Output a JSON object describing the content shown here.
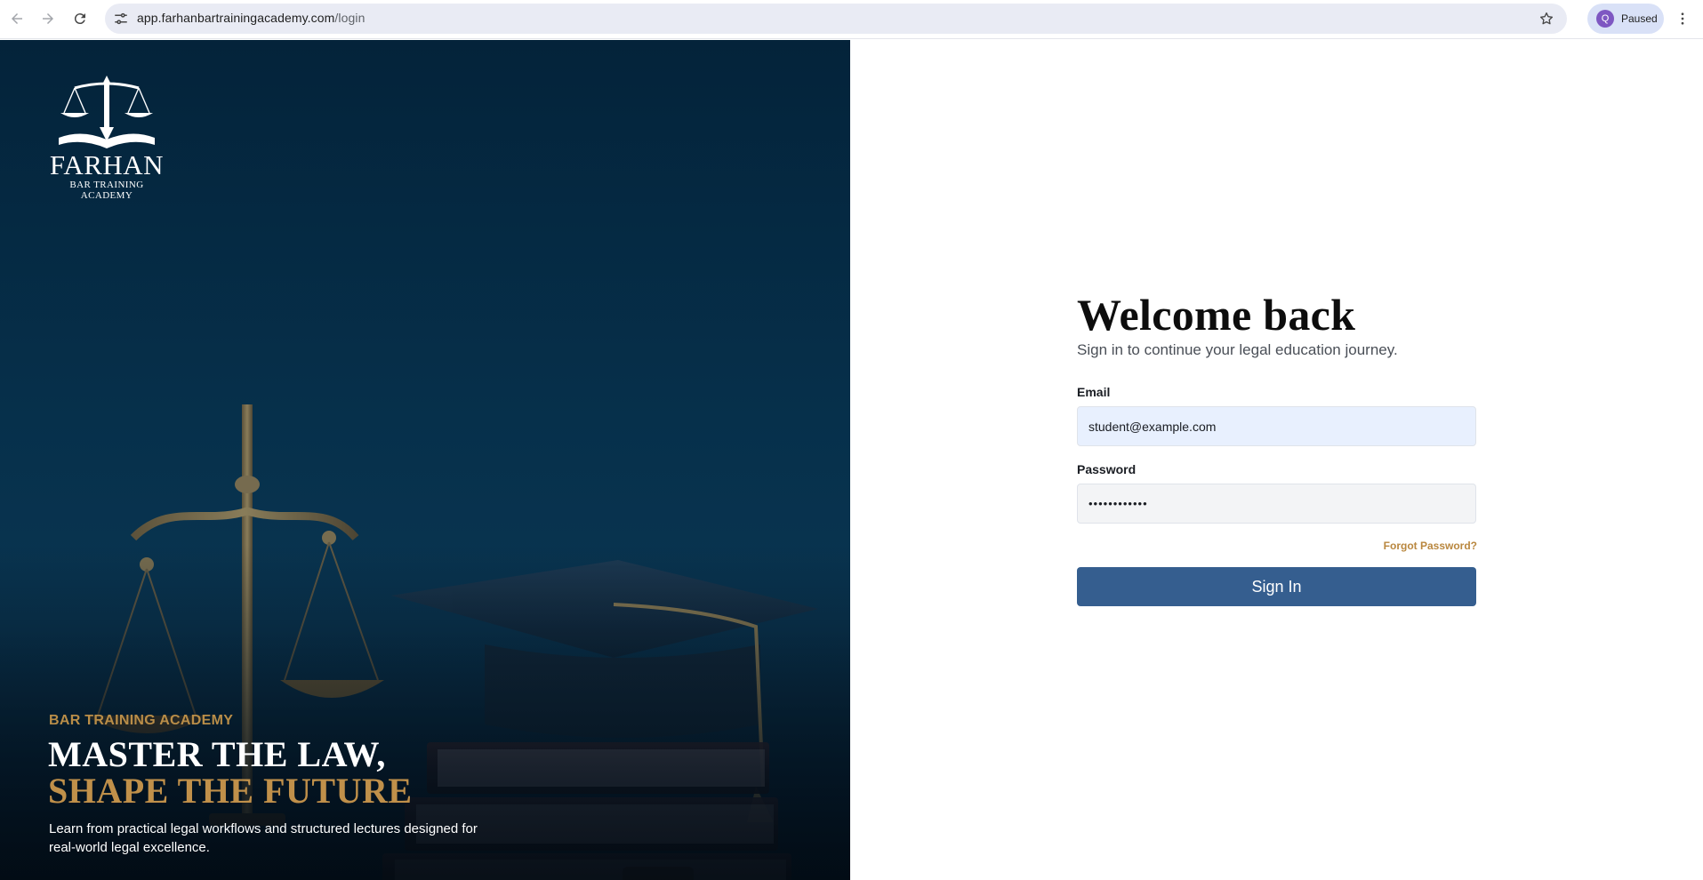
{
  "browser": {
    "url_host": "app.farhanbartrainingacademy.com",
    "url_path": "/login",
    "profile_initial": "Q",
    "profile_status": "Paused",
    "icons": [
      "back-arrow-icon",
      "forward-arrow-icon",
      "reload-icon",
      "site-settings-icon",
      "bookmark-star-icon",
      "kebab-menu-icon"
    ]
  },
  "hero": {
    "logo_name": "FARHAN",
    "logo_sub_line1": "BAR TRAINING",
    "logo_sub_line2": "ACADEMY",
    "eyebrow": "BAR TRAINING ACADEMY",
    "title_line1": "MASTER THE LAW,",
    "title_line2": "SHAPE THE FUTURE",
    "description": "Learn from practical legal workflows and structured lectures designed for real-world legal excellence.",
    "colors": {
      "background": "#06304b",
      "gold": "#c0904a"
    }
  },
  "login": {
    "heading": "Welcome back",
    "subtitle": "Sign in to continue your legal education journey.",
    "email_label": "Email",
    "email_value": "student@example.com",
    "password_label": "Password",
    "password_value": "••••••••••••",
    "forgot_label": "Forgot Password?",
    "signin_label": "Sign In",
    "colors": {
      "button": "#355e8f",
      "link": "#b9873f"
    }
  }
}
